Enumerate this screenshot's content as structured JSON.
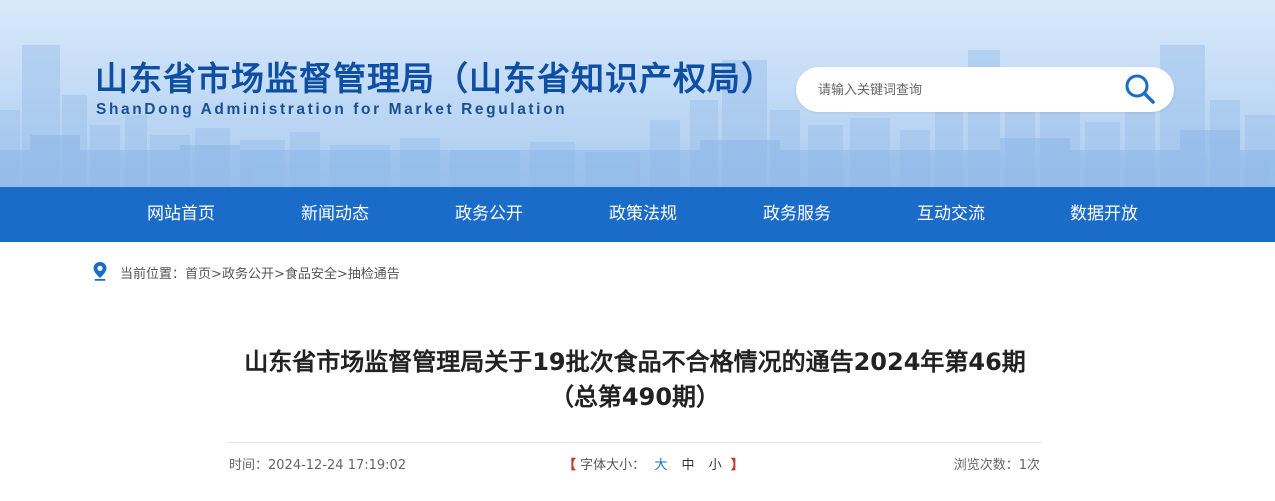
{
  "header": {
    "title": "山东省市场监督管理局（山东省知识产权局）",
    "subtitle": "ShanDong Administration for Market Regulation",
    "search_placeholder": "请输入关键词查询",
    "search_icon": "search-icon"
  },
  "nav": {
    "items": [
      {
        "label": "网站首页"
      },
      {
        "label": "新闻动态"
      },
      {
        "label": "政务公开"
      },
      {
        "label": "政策法规"
      },
      {
        "label": "政务服务"
      },
      {
        "label": "互动交流"
      },
      {
        "label": "数据开放"
      }
    ]
  },
  "breadcrumb": {
    "prefix": "当前位置：",
    "items": [
      "首页",
      "政务公开",
      "食品安全",
      "抽检通告"
    ],
    "separator": ">"
  },
  "article": {
    "title": "山东省市场监督管理局关于19批次食品不合格情况的通告2024年第46期（总第490期）",
    "time_label": "时间：",
    "time_value": "2024-12-24 17:19:02",
    "font_size_label": "字体大小：",
    "font_sizes": [
      "大",
      "中",
      "小"
    ],
    "bracket_open": "【",
    "bracket_close": "】",
    "views_label": "浏览次数：",
    "views_value": "1次"
  },
  "colors": {
    "brand_blue": "#1b6bc8",
    "title_blue": "#0f4fa3"
  }
}
